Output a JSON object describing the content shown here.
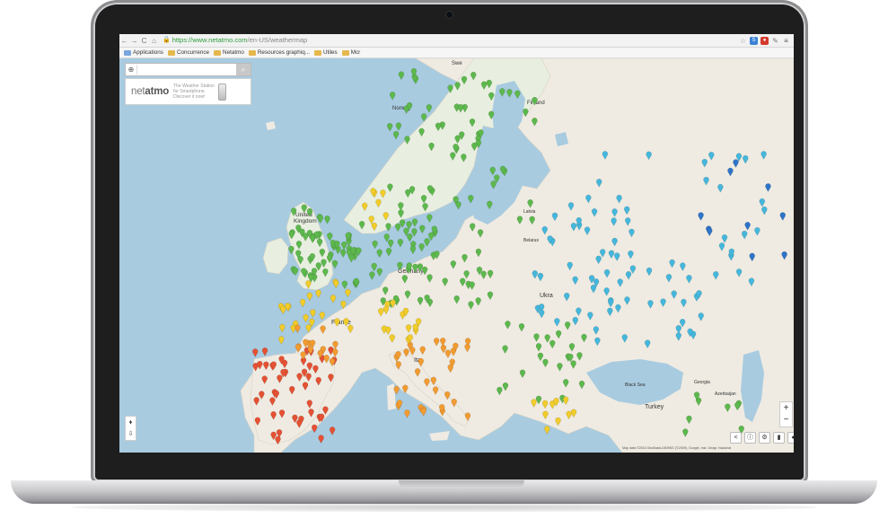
{
  "browser": {
    "url_host": "https://www.netatmo.com",
    "url_path": "/en-US/weathermap",
    "bookmarks": [
      "Applications",
      "Concurrence",
      "Netatmo",
      "Resources graphiq...",
      "Utiles",
      "Mcr"
    ]
  },
  "netatmo": {
    "logo_light": "net",
    "logo_bold": "atmo",
    "tagline": "The Weather Station for Smartphone. Discover it now!"
  },
  "map": {
    "labels": {
      "norway": "Norway",
      "finland": "Finland",
      "sweden": "Swe",
      "uk1": "United",
      "uk2": "Kingdom",
      "germany": "Germany",
      "france": "France",
      "italy": "Ita",
      "ukraine": "Ukra",
      "turkey": "Turkey",
      "latvia": "Latvia",
      "belarus": "Belarus",
      "azerbaijan": "Azerbaijan",
      "georgia": "Georgia",
      "black_sea": "Black Sea"
    },
    "zoom_in": "+",
    "zoom_out": "−",
    "attribution": "Map data ©2015 GeoBasis-DE/BKG (©2009), Google, Inst. Geogr. Nacional"
  },
  "colors": {
    "sea": "#a8cbe0",
    "land": "#efebe2",
    "green": "#5db84d",
    "yellow": "#f1cc2a",
    "orange": "#f29b31",
    "red": "#e55133",
    "cyan": "#45b7dc",
    "blue": "#2d74c9"
  }
}
